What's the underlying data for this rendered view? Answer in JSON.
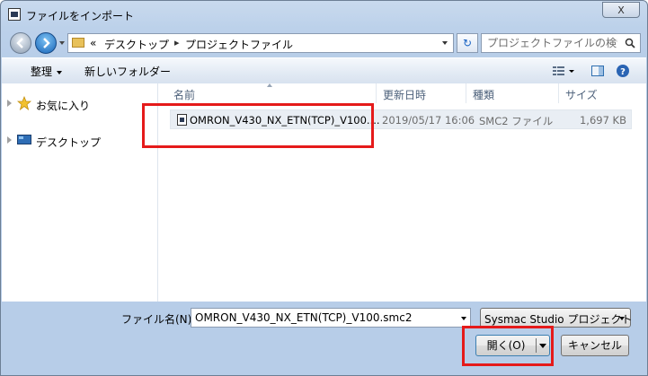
{
  "window": {
    "title": "ファイルをインポート",
    "close_label": "X"
  },
  "address": {
    "prefix": "«",
    "crumbs": [
      "デスクトップ",
      "プロジェクトファイル"
    ],
    "search_placeholder": "プロジェクトファイルの検索"
  },
  "toolbar": {
    "organize": "整理",
    "new_folder": "新しいフォルダー"
  },
  "sidebar": {
    "items": [
      {
        "label": "お気に入り",
        "icon": "star-icon"
      },
      {
        "label": "デスクトップ",
        "icon": "desktop-icon"
      }
    ]
  },
  "columns": {
    "name": "名前",
    "modified": "更新日時",
    "type": "種類",
    "size": "サイズ"
  },
  "files": [
    {
      "name": "OMRON_V430_NX_ETN(TCP)_V100....",
      "modified": "2019/05/17 16:06",
      "type": "SMC2 ファイル",
      "size": "1,697 KB"
    }
  ],
  "bottom": {
    "filename_label": "ファイル名(N):",
    "filename_value": "OMRON_V430_NX_ETN(TCP)_V100.smc2",
    "filetype": "Sysmac Studio プロジェクト",
    "open_label": "開く(O)",
    "cancel_label": "キャンセル"
  },
  "colors": {
    "highlight": "#e51a1a",
    "accent": "#1764b8"
  }
}
